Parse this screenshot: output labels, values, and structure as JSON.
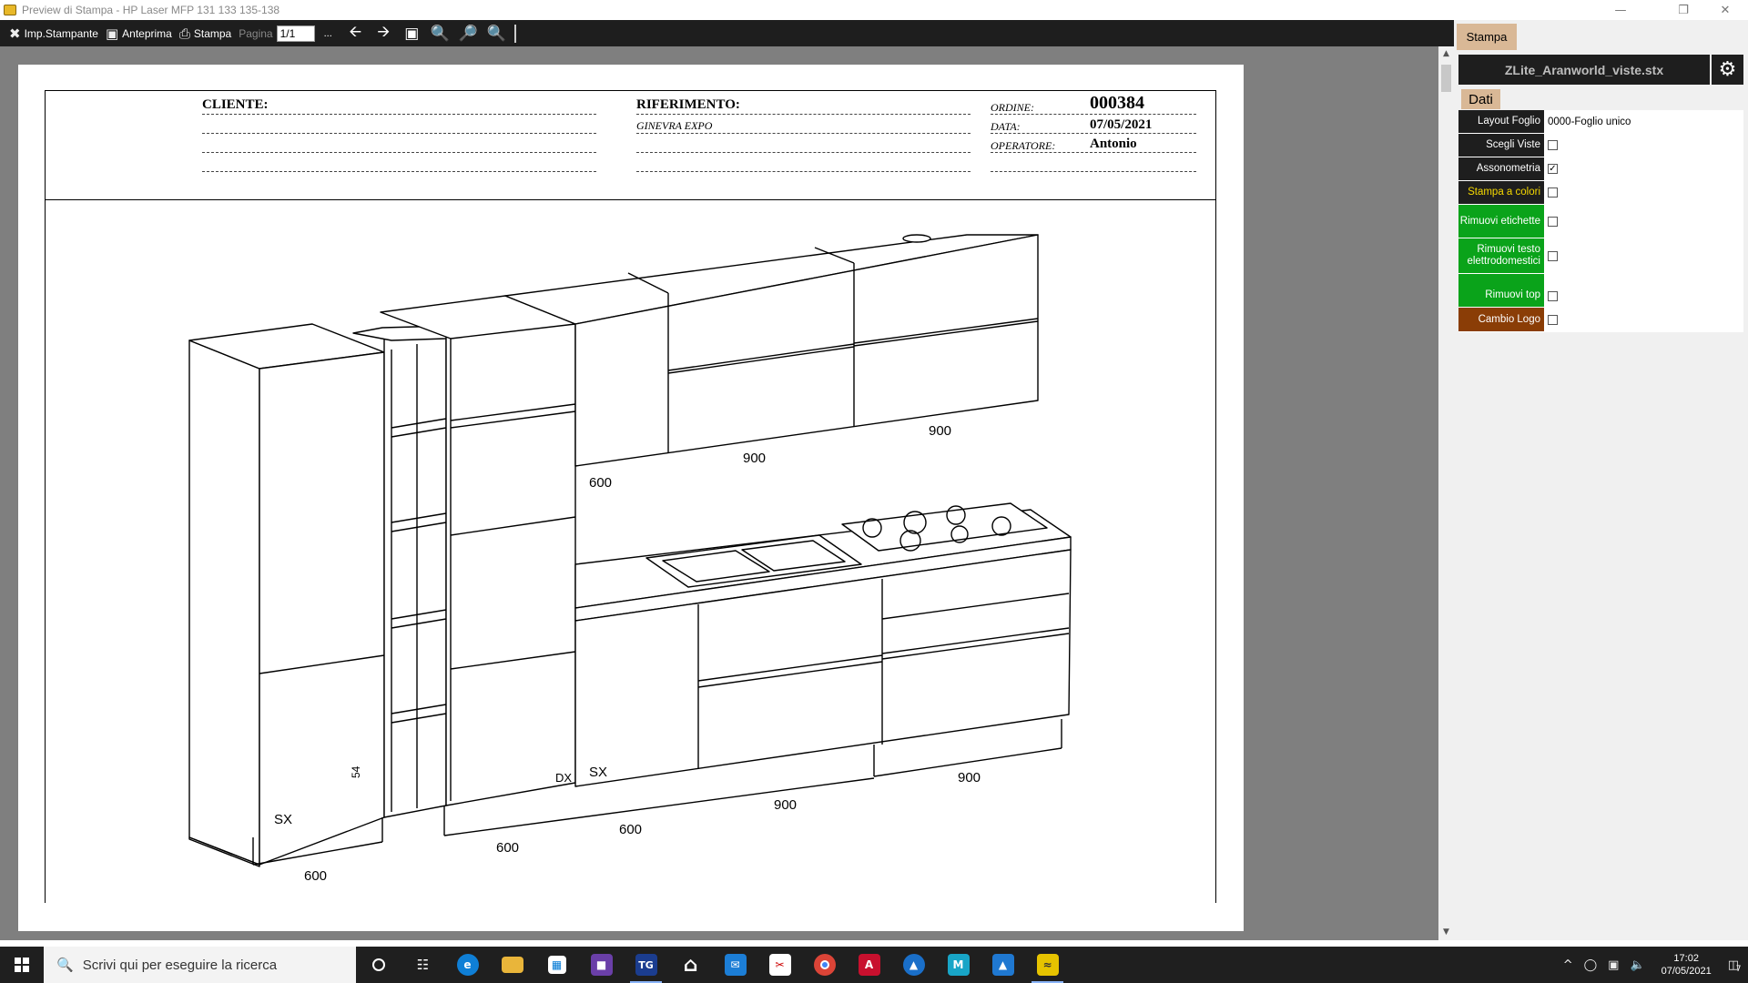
{
  "window": {
    "title": "Preview di Stampa - HP Laser MFP 131 133 135-138"
  },
  "toolbar": {
    "printer_setup": "Imp.Stampante",
    "preview": "Anteprima",
    "print": "Stampa",
    "page_label": "Pagina",
    "page_value": "1/1",
    "ellipsis": "..."
  },
  "sheet": {
    "cliente_label": "CLIENTE:",
    "riferimento_label": "RIFERIMENTO:",
    "riferimento_value": "GINEVRA EXPO",
    "ordine_label": "ORDINE:",
    "ordine_value": "000384",
    "data_label": "DATA:",
    "data_value": "07/05/2021",
    "operatore_label": "OPERATORE:",
    "operatore_value": "Antonio"
  },
  "drawing": {
    "dimensions": {
      "tall_width": "600",
      "base_left": "600",
      "base_mid": "600",
      "base_center": "900",
      "base_right": "900",
      "wall_left": "600",
      "wall_mid": "900",
      "wall_right": "900",
      "hinge_1": "SX",
      "hinge_2": "DX",
      "hinge_3": "SX",
      "side_measure": "54"
    }
  },
  "panel": {
    "tab": "Stampa",
    "file": "ZLite_Aranworld_viste.stx",
    "data_tab": "Dati",
    "rows": [
      {
        "label": "Layout Foglio",
        "value": "0000-Foglio unico",
        "color": "#1e1e1e"
      },
      {
        "label": "Scegli Viste",
        "checked": false,
        "color": "#1e1e1e"
      },
      {
        "label": "Assonometria",
        "checked": true,
        "color": "#1e1e1e"
      },
      {
        "label": "Stampa a colori",
        "checked": false,
        "color": "#1e1e1e"
      },
      {
        "label": "Rimuovi etichette",
        "checked": false,
        "color": "#0aa31a"
      },
      {
        "label": "Rimuovi testo elettrodomestici",
        "checked": false,
        "color": "#0aa31a"
      },
      {
        "label": "Rimuovi top",
        "checked": false,
        "color": "#0aa31a"
      },
      {
        "label": "Cambio Logo",
        "checked": false,
        "color": "#8a3d06"
      }
    ],
    "check_mark": "✓"
  },
  "taskbar": {
    "search_placeholder": "Scrivi qui per eseguire la ricerca",
    "time": "17:02",
    "date": "07/05/2021",
    "notifications": "7"
  }
}
